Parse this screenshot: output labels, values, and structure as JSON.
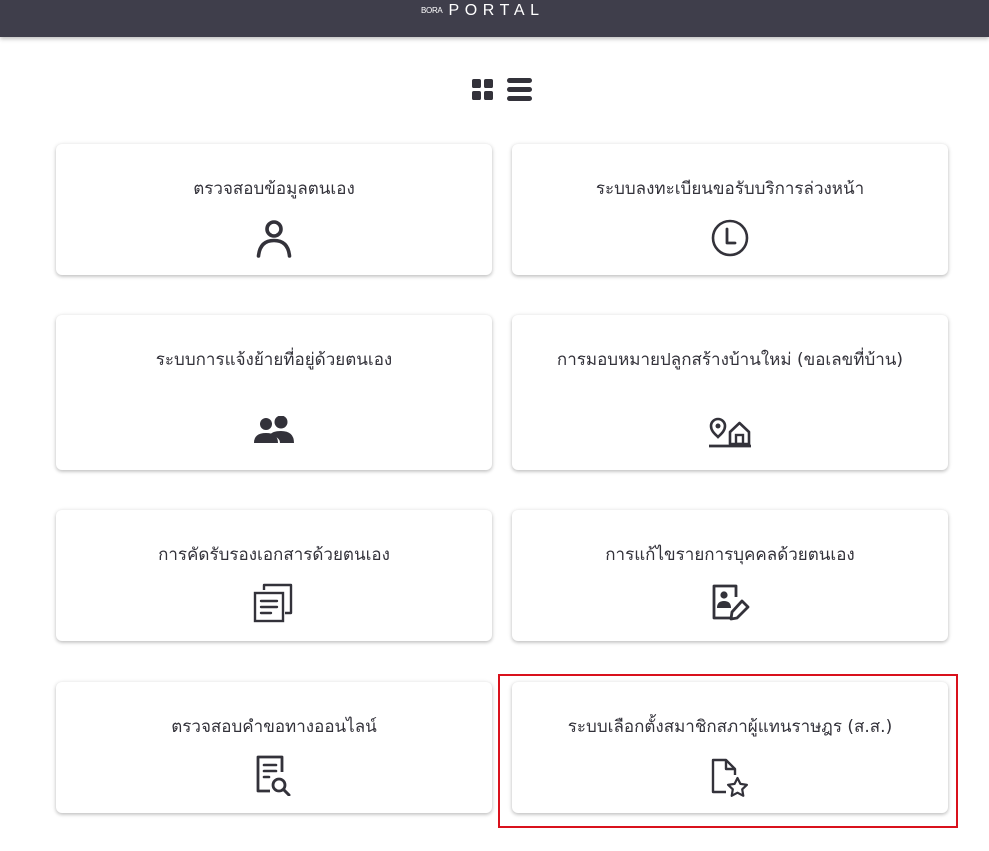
{
  "header": {
    "brand_small": "BORA",
    "brand_main": "PORTAL"
  },
  "view_toggle": {
    "grid_icon": "grid-view-icon",
    "list_icon": "list-view-icon"
  },
  "menu": {
    "cards": [
      {
        "label": "ตรวจสอบข้อมูลตนเอง",
        "icon": "user-icon"
      },
      {
        "label": "ระบบลงทะเบียนขอรับบริการล่วงหน้า",
        "icon": "clock-icon"
      },
      {
        "label": "ระบบการแจ้งย้ายที่อยู่ด้วยตนเอง",
        "icon": "users-icon"
      },
      {
        "label": "การมอบหมายปลูกสร้างบ้านใหม่ (ขอเลขที่บ้าน)",
        "icon": "location-home-icon"
      },
      {
        "label": "การคัดรับรองเอกสารด้วยตนเอง",
        "icon": "documents-copy-icon"
      },
      {
        "label": "การแก้ไขรายการบุคคลด้วยตนเอง",
        "icon": "person-edit-icon"
      },
      {
        "label": "ตรวจสอบคำขอทางออนไลน์",
        "icon": "document-search-icon"
      },
      {
        "label": "ระบบเลือกตั้งสมาชิกสภาผู้แทนราษฎร (ส.ส.)",
        "icon": "document-star-icon"
      }
    ]
  },
  "colors": {
    "header_bg": "#3f3e4b",
    "text": "#33323a",
    "highlight": "#d9111c"
  }
}
